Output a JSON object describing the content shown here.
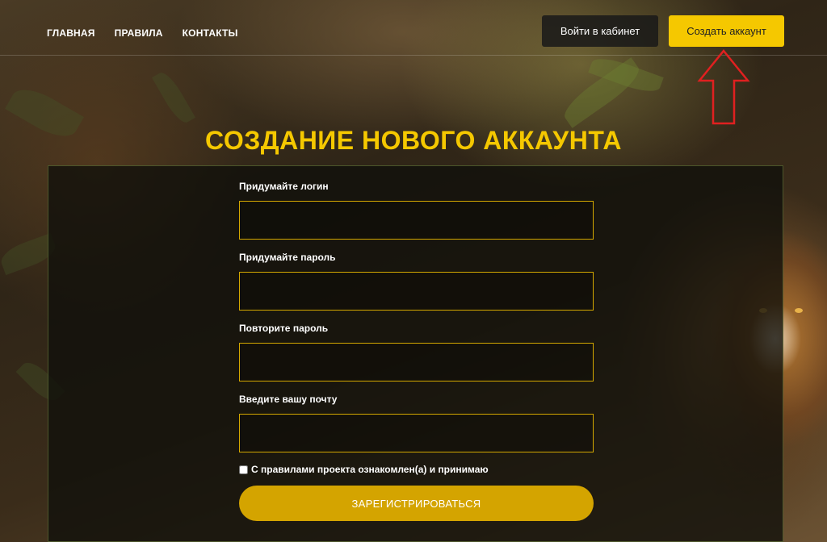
{
  "nav": {
    "items": [
      {
        "label": "ГЛАВНАЯ"
      },
      {
        "label": "ПРАВИЛА"
      },
      {
        "label": "КОНТАКТЫ"
      }
    ]
  },
  "header": {
    "login_label": "Войти в кабинет",
    "create_label": "Создать аккаунт"
  },
  "annotation": {
    "icon": "arrow-up-icon",
    "color": "#e02020"
  },
  "page": {
    "title": "СОЗДАНИЕ НОВОГО АККАУНТА"
  },
  "form": {
    "login": {
      "label": "Придумайте логин",
      "value": "",
      "placeholder": ""
    },
    "password": {
      "label": "Придумайте пароль",
      "value": "",
      "placeholder": ""
    },
    "password_repeat": {
      "label": "Повторите пароль",
      "value": "",
      "placeholder": ""
    },
    "email": {
      "label": "Введите вашу почту",
      "value": "",
      "placeholder": ""
    },
    "agree_label": "С правилами проекта ознакомлен(а) и принимаю",
    "agree_checked": false,
    "submit_label": "ЗАРЕГИСТРИРОВАТЬСЯ"
  },
  "colors": {
    "accent": "#f5c800",
    "submit": "#d4a400",
    "field_border": "#d4a800",
    "dark_button": "#191919"
  }
}
